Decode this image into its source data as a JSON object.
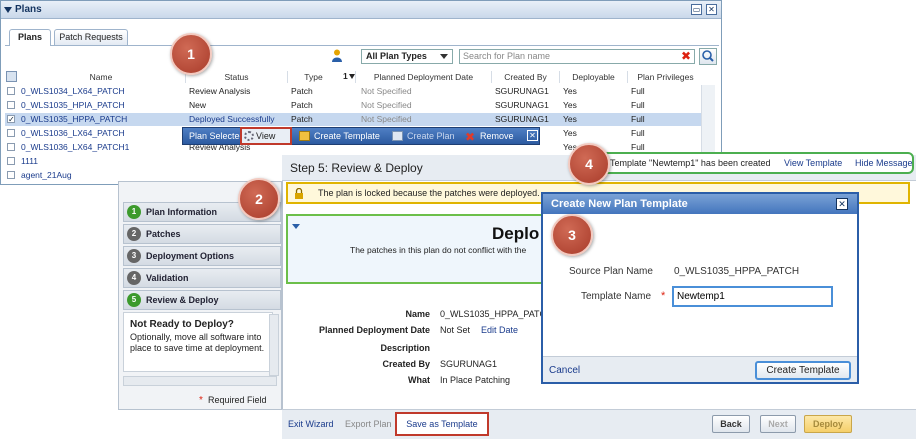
{
  "plans": {
    "title": "Plans",
    "tabs": [
      {
        "label": "Plans"
      },
      {
        "label": "Patch Requests"
      }
    ],
    "filter": {
      "value": "All Plan Types"
    },
    "search": {
      "placeholder": "Search for Plan name"
    },
    "columns": {
      "name": "Name",
      "status": "Status",
      "type": "Type",
      "sort": "1",
      "date": "Planned Deployment Date",
      "created": "Created By",
      "deployable": "Deployable",
      "priv": "Plan Privileges"
    },
    "rows": [
      {
        "name": "0_WLS1034_LX64_PATCH",
        "status": "Review Analysis",
        "type": "Patch",
        "date": "Not Specified",
        "created": "SGURUNAG1",
        "deployable": "Yes",
        "priv": "Full"
      },
      {
        "name": "0_WLS1035_HPIA_PATCH",
        "status": "New",
        "type": "Patch",
        "date": "Not Specified",
        "created": "SGURUNAG1",
        "deployable": "Yes",
        "priv": "Full"
      },
      {
        "name": "0_WLS1035_HPPA_PATCH",
        "status": "Deployed Successfully",
        "type": "Patch",
        "date": "Not Specified",
        "created": "SGURUNAG1",
        "deployable": "Yes",
        "priv": "Full"
      },
      {
        "name": "0_WLS1036_LX64_PATCH",
        "status": "",
        "type": "",
        "date": "",
        "created": "",
        "deployable": "Yes",
        "priv": "Full"
      },
      {
        "name": "0_WLS1036_LX64_PATCH1",
        "status": "Review Analysis",
        "type": "",
        "date": "",
        "created": "",
        "deployable": "Yes",
        "priv": "Full"
      },
      {
        "name": "1111",
        "status": "",
        "type": "",
        "date": "",
        "created": "",
        "deployable": "",
        "priv": ""
      },
      {
        "name": "agent_21Aug",
        "status": "",
        "type": "",
        "date": "",
        "created": "",
        "deployable": "",
        "priv": ""
      }
    ]
  },
  "toolbar": {
    "plan_selected": "Plan Selected",
    "view": "View",
    "create_template": "Create Template",
    "create_plan": "Create Plan",
    "remove": "Remove"
  },
  "wizard": {
    "steps": [
      {
        "num": "1",
        "label": "Plan Information"
      },
      {
        "num": "2",
        "label": "Patches"
      },
      {
        "num": "3",
        "label": "Deployment Options"
      },
      {
        "num": "4",
        "label": "Validation"
      },
      {
        "num": "5",
        "label": "Review & Deploy"
      }
    ],
    "notready_title": "Not Ready to Deploy?",
    "notready_text": "Optionally, move all software into place to save time at deployment.",
    "required": "Required Field"
  },
  "step5": {
    "title": "Step 5: Review & Deploy",
    "lock_msg": "The plan is locked because the patches were deployed.",
    "deploy_title": "Deplo",
    "deploy_text": "The patches in this plan do not conflict with the",
    "details": [
      {
        "label": "Name",
        "value": "0_WLS1035_HPPA_PATCH"
      },
      {
        "label": "Planned Deployment Date",
        "value": "Not Set"
      },
      {
        "label": "Description",
        "value": ""
      },
      {
        "label": "Created By",
        "value": "SGURUNAG1"
      },
      {
        "label": "What",
        "value": "In Place Patching"
      }
    ],
    "edit_date": "Edit Date",
    "footer": {
      "exit": "Exit Wizard",
      "export": "Export Plan",
      "save_template": "Save as Template",
      "back": "Back",
      "next": "Next",
      "deploy": "Deploy"
    }
  },
  "notification": {
    "message": "Template \"Newtemp1\" has been created",
    "view_template": "View Template",
    "hide_message": "Hide Message"
  },
  "dialog": {
    "title": "Create New Plan Template",
    "source_label": "Source Plan Name",
    "source_value": "0_WLS1035_HPPA_PATCH",
    "template_label": "Template Name",
    "template_value": "Newtemp1",
    "cancel": "Cancel",
    "create": "Create Template"
  },
  "callouts": [
    "1",
    "2",
    "3",
    "4"
  ],
  "colors": {
    "accent": "#2b5ea8",
    "callout": "#b94a38",
    "highlight": "#c0392b",
    "success_border": "#4caf50",
    "lock_border": "#e0b400"
  }
}
